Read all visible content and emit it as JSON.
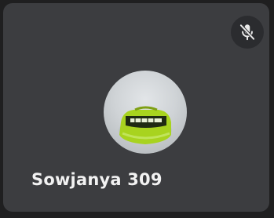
{
  "participant": {
    "display_name": "Sowjanya 309",
    "microphone_state": "muted",
    "mute_icon": "microphone-off-icon",
    "avatar_icon": "profile-photo"
  },
  "colors": {
    "tile_background": "#3c3d40",
    "page_background": "#1f1f20",
    "mute_button_background": "#2b2c2f",
    "name_text": "#f2f2f2",
    "avatar_accent": "#a8d31f"
  }
}
